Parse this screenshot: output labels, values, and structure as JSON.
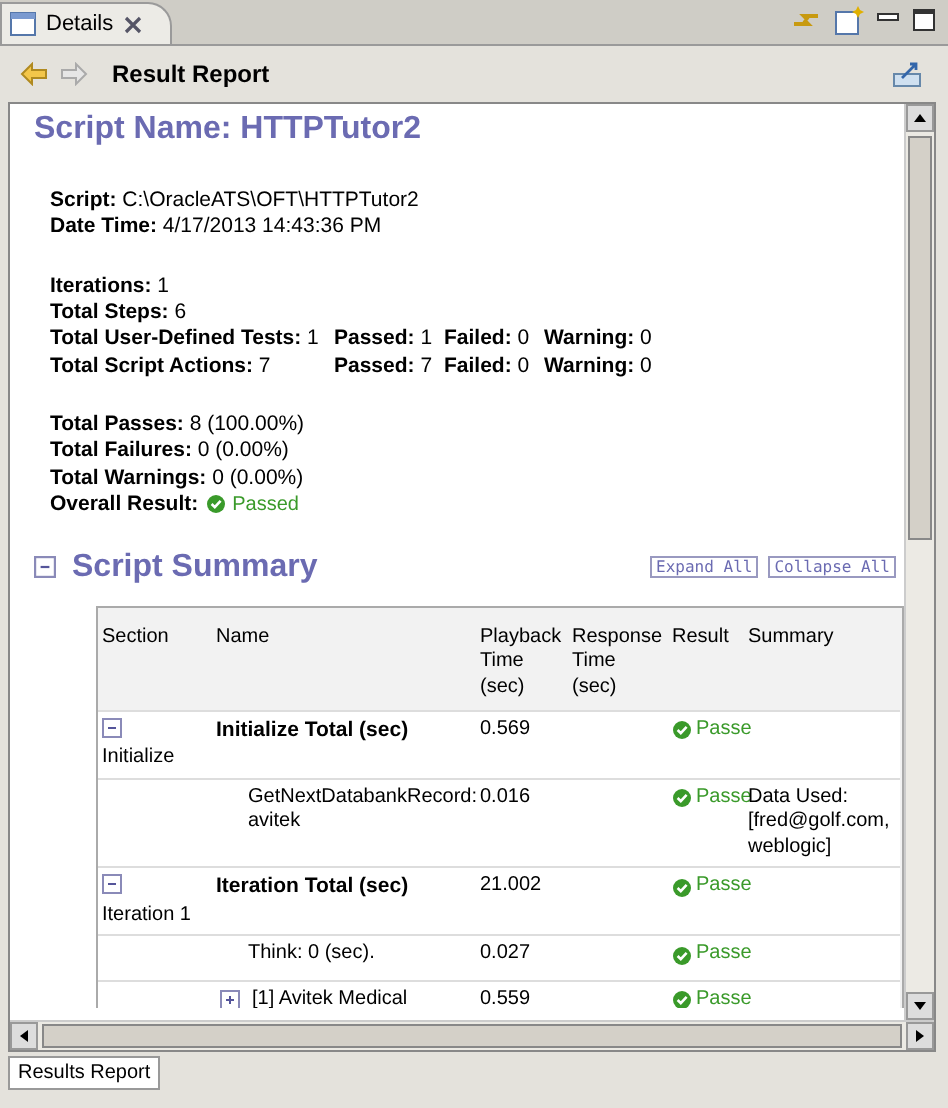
{
  "view_tab": {
    "title": "Details"
  },
  "header": {
    "title": "Result Report"
  },
  "report": {
    "script_name_label": "Script Name:",
    "script_name": "HTTPTutor2",
    "info_groups": [
      [
        {
          "label": "Script:",
          "value": "C:\\OracleATS\\OFT\\HTTPTutor2"
        },
        {
          "label": "Date Time:",
          "value": "4/17/2013 14:43:36 PM"
        }
      ],
      [
        {
          "label": "Iterations:",
          "value": "1"
        },
        {
          "label": "Total Steps:",
          "value": "6"
        },
        {
          "label": "Total User-Defined Tests:",
          "value": "1",
          "extra": [
            {
              "label": "Passed:",
              "value": "1"
            },
            {
              "label": "Failed:",
              "value": "0"
            },
            {
              "label": "Warning:",
              "value": "0"
            }
          ]
        },
        {
          "label": "Total Script Actions:",
          "value": "7",
          "extra": [
            {
              "label": "Passed:",
              "value": "7"
            },
            {
              "label": "Failed:",
              "value": "0"
            },
            {
              "label": "Warning:",
              "value": "0"
            }
          ]
        }
      ],
      [
        {
          "label": "Total Passes:",
          "value": "8 (100.00%)"
        },
        {
          "label": "Total Failures:",
          "value": "0 (0.00%)"
        },
        {
          "label": "Total Warnings:",
          "value": "0 (0.00%)"
        },
        {
          "label": "Overall Result:",
          "value": "Passed",
          "passed": true
        }
      ]
    ]
  },
  "summary": {
    "title": "Script Summary",
    "expanded": true,
    "buttons": [
      "Expand All",
      "Collapse All"
    ],
    "columns": [
      "Section",
      "Name",
      "Playback Time (sec)",
      "Response Time (sec)",
      "Result",
      "Summary"
    ],
    "rows": [
      {
        "kind": "group",
        "section": "Initialize",
        "expanded": true,
        "name": "Initialize Total (sec)",
        "playback": "0.569",
        "result": "Passe",
        "passed": true
      },
      {
        "kind": "step",
        "name": "GetNextDatabankRecord: avitek",
        "playback": "0.016",
        "result": "Passe",
        "passed": true,
        "summary": "Data Used: [fred@golf.com, weblogic]"
      },
      {
        "kind": "group",
        "section": "Iteration 1",
        "expanded": true,
        "name": "Iteration Total (sec)",
        "playback": "21.002",
        "result": "Passe",
        "passed": true
      },
      {
        "kind": "step",
        "name": "Think: 0 (sec).",
        "playback": "0.027",
        "result": "Passe",
        "passed": true
      },
      {
        "kind": "step",
        "expanded": false,
        "name": "[1] Avitek Medical",
        "playback": "0.559",
        "result": "Passe",
        "passed": true
      }
    ]
  },
  "bottom_tab": {
    "title": "Results Report"
  }
}
